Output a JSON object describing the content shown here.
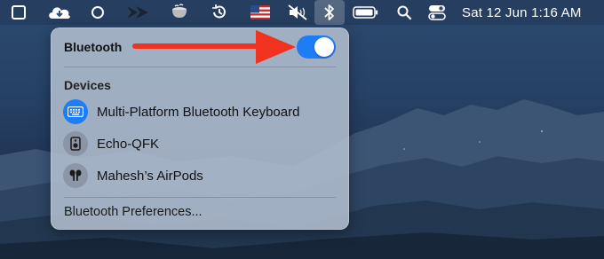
{
  "menubar": {
    "icons": [
      "square-icon",
      "cloud-icon",
      "circle-icon",
      "chevron-arrows-icon",
      "cup-icon",
      "time-machine-icon",
      "flag-icon",
      "mute-icon",
      "bluetooth-icon",
      "battery-icon",
      "search-icon",
      "control-center-icon"
    ],
    "clock": "Sat 12 Jun  1:16 AM"
  },
  "bluetooth_panel": {
    "title": "Bluetooth",
    "toggle_on": true,
    "devices_label": "Devices",
    "devices": [
      {
        "name": "Multi-Platform Bluetooth Keyboard",
        "icon": "keyboard-icon",
        "connected": true
      },
      {
        "name": "Echo-QFK",
        "icon": "speaker-icon",
        "connected": false
      },
      {
        "name": "Mahesh’s AirPods",
        "icon": "airpods-icon",
        "connected": false
      }
    ],
    "preferences_label": "Bluetooth Preferences..."
  },
  "colors": {
    "accent": "#1e7cf5",
    "arrow": "#f0321e",
    "panel": "#b0becf"
  }
}
